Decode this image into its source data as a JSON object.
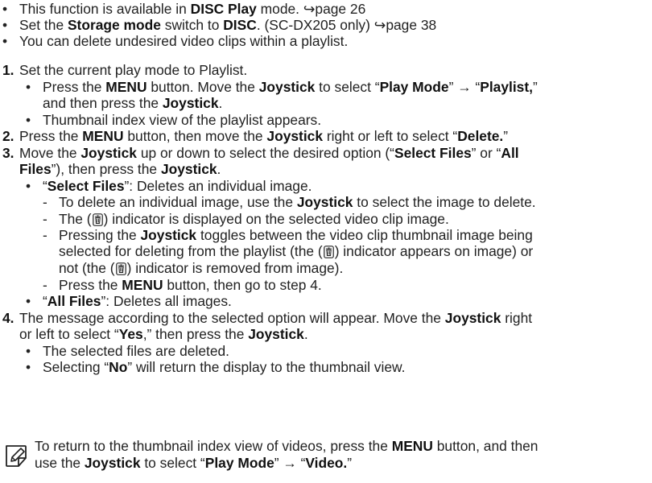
{
  "intro": [
    {
      "segments": [
        "This function is available in ",
        "DISC Play",
        " mode. ↪page 26"
      ],
      "bold": [
        1
      ]
    },
    {
      "segments": [
        "Set the ",
        "Storage mode",
        " switch to ",
        "DISC",
        ". (SC-DX205 only) ↪page 38"
      ],
      "bold": [
        1,
        3
      ]
    },
    {
      "segments": [
        "You can delete undesired video clips within a playlist."
      ],
      "bold": []
    }
  ],
  "steps": {
    "s1_num": "1.",
    "s1_text": "Set the current play mode to Playlist.",
    "s1_b1_l1": [
      "Press the ",
      "MENU",
      " button. Move the ",
      "Joystick",
      " to select “",
      "Play Mode",
      "” → “",
      "Playlist,",
      "”"
    ],
    "s1_b1_l2": [
      "and then press the ",
      "Joystick",
      "."
    ],
    "s1_b2": "Thumbnail index view of the playlist appears.",
    "s2_num": "2.",
    "s2": [
      "Press the ",
      "MENU",
      " button, then move the ",
      "Joystick",
      " right or left to select “",
      "Delete.",
      "”"
    ],
    "s3_num": "3.",
    "s3_l1": [
      "Move the ",
      "Joystick",
      " up or down to select the desired option (“",
      "Select Files",
      "” or “",
      "All"
    ],
    "s3_l2": [
      "Files",
      "”), then press the ",
      "Joystick",
      "."
    ],
    "s3_b1": [
      "“",
      "Select Files",
      "”: Deletes an individual image."
    ],
    "s3_d1": [
      "To delete an individual image, use the ",
      "Joystick",
      " to select the image to delete."
    ],
    "s3_d2": [
      "The (",
      "",
      ") indicator is displayed on the selected video clip image."
    ],
    "s3_d3_l1": [
      "Pressing the ",
      "Joystick",
      " toggles between the video clip thumbnail image being"
    ],
    "s3_d3_l2": [
      "selected for deleting from the playlist (the (",
      "",
      ") indicator appears on image) or"
    ],
    "s3_d3_l3": [
      "not (the (",
      "",
      ") indicator is removed from image)."
    ],
    "s3_d4": [
      "Press the ",
      "MENU",
      " button, then go to step 4."
    ],
    "s3_b2": [
      "“",
      "All Files",
      "”: Deletes all images."
    ],
    "s4_num": "4.",
    "s4_l1": [
      "The message according to the selected option will appear. Move the ",
      "Joystick",
      " right"
    ],
    "s4_l2": [
      "or left to select “",
      "Yes",
      ",” then press the ",
      "Joystick",
      "."
    ],
    "s4_b1": "The selected files are deleted.",
    "s4_b2": [
      "Selecting “",
      "No",
      "” will return the display to the thumbnail view."
    ]
  },
  "note": {
    "icon": "note-pencil-icon",
    "l1": [
      "To return to the thumbnail index view of videos, press the ",
      "MENU",
      " button, and then"
    ],
    "l2": [
      "use the ",
      "Joystick",
      " to select “",
      "Play Mode",
      "” → “",
      "Video.",
      "”"
    ]
  }
}
